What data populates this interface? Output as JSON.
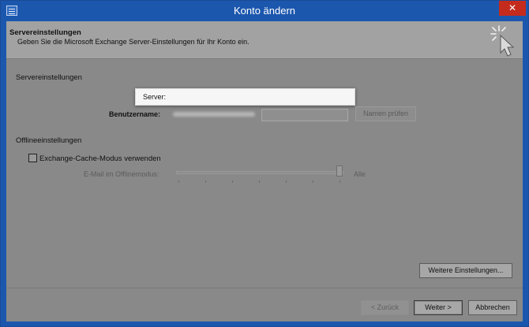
{
  "window": {
    "title": "Konto ändern",
    "close_glyph": "✕",
    "system_icon": "outlook-app-icon"
  },
  "header": {
    "title": "Servereinstellungen",
    "subtitle": "Geben Sie die Microsoft Exchange Server-Einstellungen für Ihr Konto ein.",
    "icon": "wizard-cursor-sparkle-icon"
  },
  "server_section": {
    "heading": "Servereinstellungen",
    "server_label": "Server:",
    "server_value": "",
    "username_label": "Benutzername:",
    "username_value": "",
    "check_names_button": "Namen prüfen"
  },
  "offline_section": {
    "heading": "Offlineeinstellungen",
    "cache_mode_label": "Exchange-Cache-Modus verwenden",
    "cache_mode_checked": false,
    "offline_mail_label": "E-Mail im Offlinemodus:",
    "slider_value_label": "Alle",
    "slider_fraction": 1.0
  },
  "buttons": {
    "more_settings": "Weitere Einstellungen...",
    "back": "< Zurück",
    "next": "Weiter >",
    "cancel": "Abbrechen"
  },
  "colors": {
    "titlebar": "#1c57ae",
    "close": "#c42b1c",
    "dimmed_client": "#898989"
  }
}
